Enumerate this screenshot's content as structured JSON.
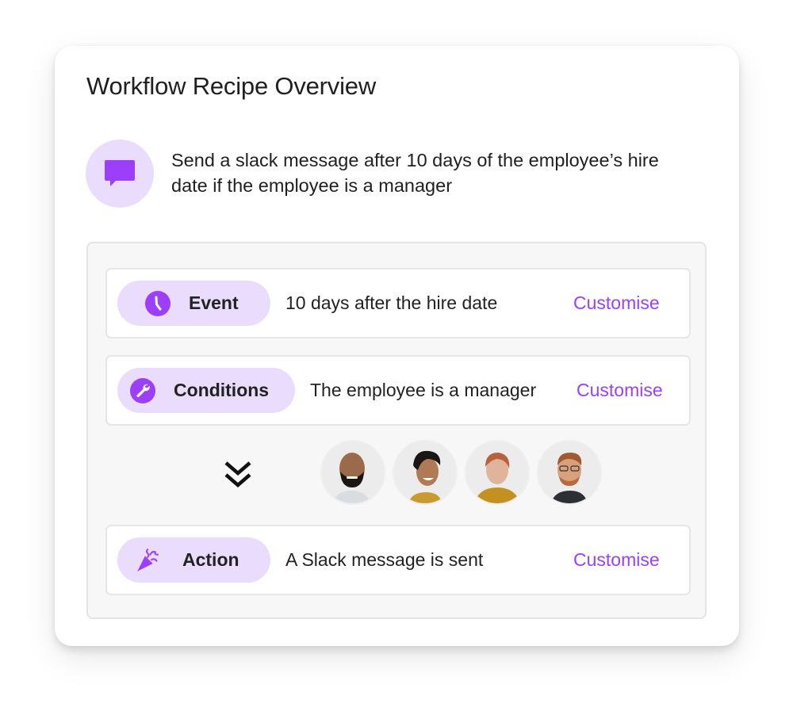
{
  "card": {
    "title": "Workflow Recipe Overview",
    "summary_icon": "chat-bubble-icon",
    "summary_text": "Send a slack message after 10 days of the employee’s hire date if the employee is a manager"
  },
  "steps": [
    {
      "label": "Event",
      "icon": "clock-icon",
      "description": "10 days after the hire date",
      "action_label": "Customise"
    },
    {
      "label": "Conditions",
      "icon": "wrench-icon",
      "description": "The employee is a manager",
      "action_label": "Customise"
    },
    {
      "label": "Action",
      "icon": "party-popper-icon",
      "description": "A Slack message is sent",
      "action_label": "Customise"
    }
  ],
  "flow": {
    "connector_icon": "double-chevron-down-icon",
    "recipients": [
      {
        "name": "avatar-man-bald-beard"
      },
      {
        "name": "avatar-woman-curly-hair"
      },
      {
        "name": "avatar-woman-short-red-hair"
      },
      {
        "name": "avatar-man-glasses"
      }
    ]
  },
  "colors": {
    "accent": "#9b3ffb",
    "accent_light": "#eadcfc",
    "text": "#1f1f1f",
    "panel_bg": "#f7f7f7",
    "border": "#e4e4e4"
  }
}
